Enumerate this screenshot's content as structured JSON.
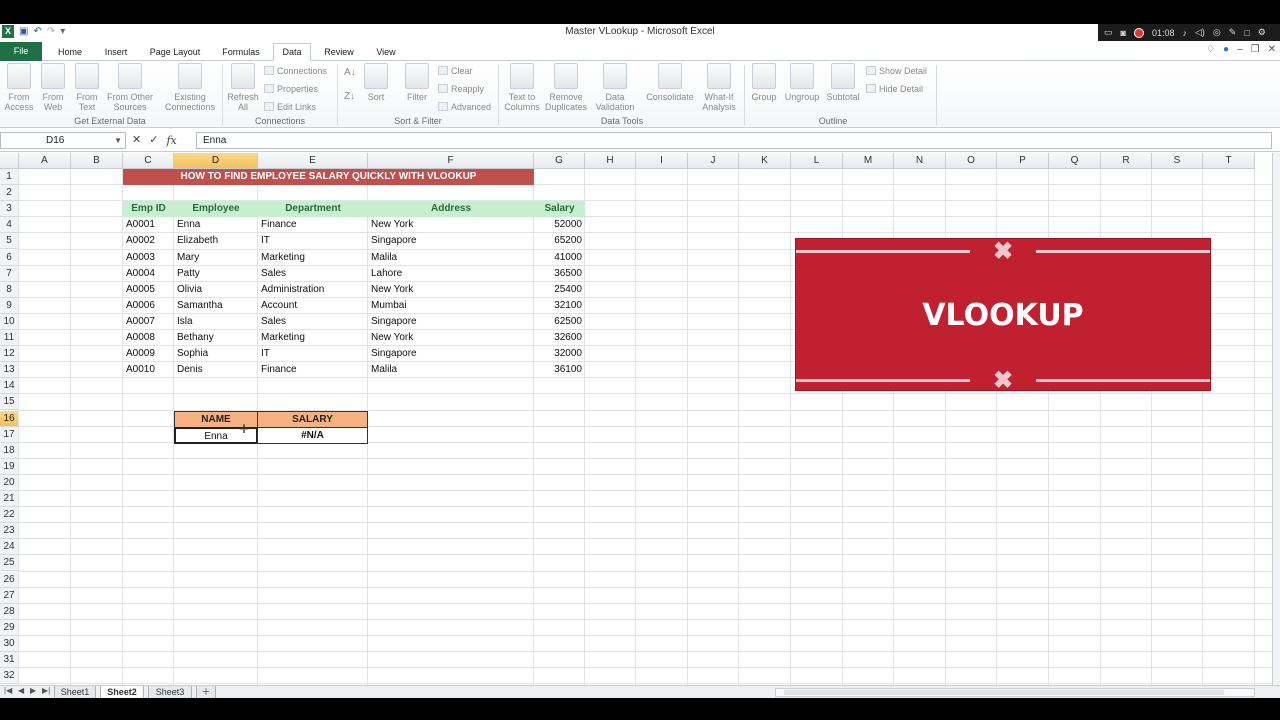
{
  "window": {
    "title": "Master VLookup  -  Microsoft Excel",
    "tray_time": "01:08"
  },
  "tabs": [
    "File",
    "Home",
    "Insert",
    "Page Layout",
    "Formulas",
    "Data",
    "Review",
    "View"
  ],
  "active_tab": "Data",
  "ribbon": {
    "get_external": {
      "from_access": "From\nAccess",
      "from_web": "From\nWeb",
      "from_text": "From\nText",
      "from_other": "From Other\nSources",
      "existing": "Existing\nConnections",
      "label": "Get External Data"
    },
    "connections": {
      "refresh": "Refresh\nAll",
      "connections": "Connections",
      "properties": "Properties",
      "edit_links": "Edit Links",
      "label": "Connections"
    },
    "sort_filter": {
      "sort": "Sort",
      "filter": "Filter",
      "clear": "Clear",
      "reapply": "Reapply",
      "advanced": "Advanced",
      "label": "Sort & Filter"
    },
    "data_tools": {
      "text_to_columns": "Text to\nColumns",
      "remove_duplicates": "Remove\nDuplicates",
      "data_validation": "Data\nValidation",
      "consolidate": "Consolidate",
      "what_if": "What-If\nAnalysis",
      "label": "Data Tools"
    },
    "outline": {
      "group": "Group",
      "ungroup": "Ungroup",
      "subtotal": "Subtotal",
      "show_detail": "Show Detail",
      "hide_detail": "Hide Detail",
      "label": "Outline"
    }
  },
  "formula_bar": {
    "name_box": "D16",
    "value": "Enna"
  },
  "columns": [
    "A",
    "B",
    "C",
    "D",
    "E",
    "F",
    "G",
    "H",
    "I",
    "J",
    "K",
    "L",
    "M",
    "N",
    "O",
    "P",
    "Q",
    "R",
    "S",
    "T"
  ],
  "selected_column": "D",
  "rows": [
    "1",
    "2",
    "3",
    "4",
    "5",
    "6",
    "7",
    "8",
    "9",
    "10",
    "11",
    "12",
    "13",
    "14",
    "15",
    "16",
    "17",
    "18",
    "19",
    "20",
    "21",
    "22",
    "23",
    "24",
    "25",
    "26",
    "27",
    "28",
    "29",
    "30",
    "31",
    "32"
  ],
  "selected_row": "16",
  "sheet": {
    "banner": "HOW TO FIND EMPLOYEE SALARY QUICKLY WITH VLOOKUP",
    "headers": {
      "emp_id": "Emp ID",
      "employee": "Employee",
      "department": "Department",
      "address": "Address",
      "salary": "Salary"
    },
    "records": [
      [
        "A0001",
        "Enna",
        "Finance",
        "New York",
        "52000"
      ],
      [
        "A0002",
        "Elizabeth",
        "IT",
        "Singapore",
        "65200"
      ],
      [
        "A0003",
        "Mary",
        "Marketing",
        "Malila",
        "41000"
      ],
      [
        "A0004",
        "Patty",
        "Sales",
        "Lahore",
        "36500"
      ],
      [
        "A0005",
        "Olivia",
        "Administration",
        "New York",
        "25400"
      ],
      [
        "A0006",
        "Samantha",
        "Account",
        "Mumbai",
        "32100"
      ],
      [
        "A0007",
        "Isla",
        "Sales",
        "Singapore",
        "62500"
      ],
      [
        "A0008",
        "Bethany",
        "Marketing",
        "New York",
        "32600"
      ],
      [
        "A0009",
        "Sophia",
        "IT",
        "Singapore",
        "32000"
      ],
      [
        "A0010",
        "Denis",
        "Finance",
        "Malila",
        "36100"
      ]
    ],
    "lookup": {
      "name_header": "NAME",
      "salary_header": "SALARY",
      "name_value": "Enna",
      "salary_value": "#N/A"
    },
    "graphic_title": "VLOOKUP"
  },
  "sheet_tabs": [
    "Sheet1",
    "Sheet2",
    "Sheet3"
  ],
  "active_sheet": "Sheet2",
  "colors": {
    "file_tab": "#1e7145",
    "banner": "#c0504d",
    "header_fill": "#c7efcf",
    "lookup_header": "#f6b183",
    "graphic": "#c0202f",
    "selection": "#f1c15a"
  }
}
